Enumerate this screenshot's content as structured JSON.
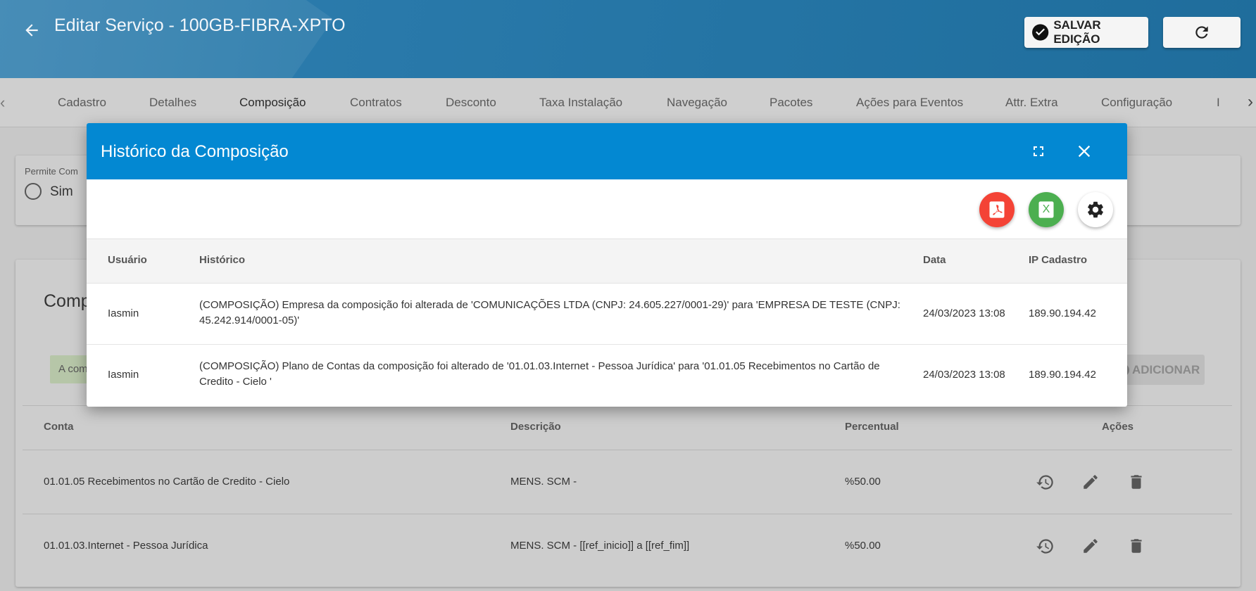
{
  "header": {
    "title": "Editar Serviço - 100GB-FIBRA-XPTO",
    "save_label": "SALVAR EDIÇÃO"
  },
  "tabs": [
    {
      "label": "Cadastro",
      "active": false
    },
    {
      "label": "Detalhes",
      "active": false
    },
    {
      "label": "Composição",
      "active": true
    },
    {
      "label": "Contratos",
      "active": false
    },
    {
      "label": "Desconto",
      "active": false
    },
    {
      "label": "Taxa Instalação",
      "active": false
    },
    {
      "label": "Navegação",
      "active": false
    },
    {
      "label": "Pacotes",
      "active": false
    },
    {
      "label": "Ações para Eventos",
      "active": false
    },
    {
      "label": "Attr. Extra",
      "active": false
    },
    {
      "label": "Configuração",
      "active": false
    },
    {
      "label": "I",
      "active": false
    }
  ],
  "background": {
    "permite_label": "Permite Com",
    "radio_label": "Sim",
    "section_title": "Comp",
    "alert_text": "A com",
    "add_label": "ADICIONAR",
    "columns": {
      "conta": "Conta",
      "descricao": "Descrição",
      "percentual": "Percentual",
      "acoes": "Ações"
    },
    "rows": [
      {
        "conta": "01.01.05 Recebimentos no Cartão de Credito - Cielo",
        "descricao": "MENS. SCM -",
        "percentual": "%50.00"
      },
      {
        "conta": "01.01.03.Internet - Pessoa Jurídica",
        "descricao": "MENS. SCM - [[ref_inicio]] a [[ref_fim]]",
        "percentual": "%50.00"
      }
    ]
  },
  "modal": {
    "title": "Histórico da Composição",
    "xls_letter": "X",
    "columns": {
      "usuario": "Usuário",
      "historico": "Histórico",
      "data": "Data",
      "ip": "IP Cadastro"
    },
    "rows": [
      {
        "usuario": "Iasmin",
        "historico": "(COMPOSIÇÃO) Empresa da composição foi alterada de 'COMUNICAÇÕES LTDA (CNPJ: 24.605.227/0001-29)' para 'EMPRESA DE TESTE (CNPJ: 45.242.914/0001-05)'",
        "data": "24/03/2023 13:08",
        "ip": "189.90.194.42"
      },
      {
        "usuario": "Iasmin",
        "historico": "(COMPOSIÇÃO) Plano de Contas da composição foi alterado de '01.01.03.Internet - Pessoa Jurídica' para '01.01.05 Recebimentos no Cartão de Credito - Cielo '",
        "data": "24/03/2023 13:08",
        "ip": "189.90.194.42"
      }
    ]
  },
  "colors": {
    "header": "#2474a4",
    "modal_header": "#0388d2",
    "pdf": "#f44336",
    "xls": "#4caf50"
  },
  "icons": [
    "arrow-left-icon",
    "check-circle-icon",
    "refresh-icon",
    "fullscreen-icon",
    "close-icon",
    "pdf-icon",
    "excel-icon",
    "gear-icon",
    "history-icon",
    "pencil-icon",
    "trash-icon"
  ]
}
